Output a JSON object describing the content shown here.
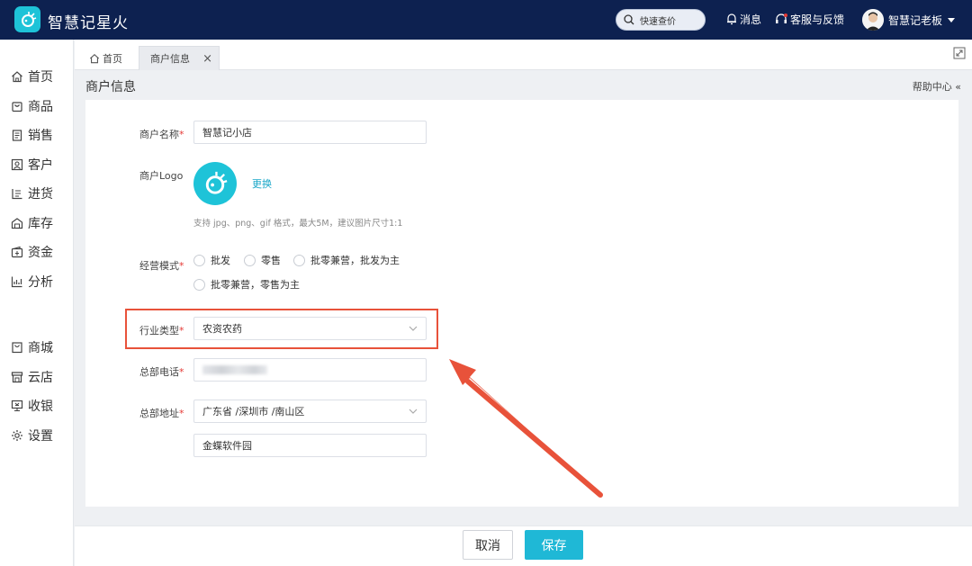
{
  "app": {
    "name": "智慧记星火"
  },
  "header": {
    "quick_search": "快速查价",
    "messages": "消息",
    "support": "客服与反馈",
    "user_name": "智慧记老板"
  },
  "sidebar": {
    "items": [
      {
        "label": "首页",
        "icon": "home-icon"
      },
      {
        "label": "商品",
        "icon": "bag-icon"
      },
      {
        "label": "销售",
        "icon": "clipboard-icon"
      },
      {
        "label": "客户",
        "icon": "contact-icon"
      },
      {
        "label": "进货",
        "icon": "purchase-icon"
      },
      {
        "label": "库存",
        "icon": "warehouse-icon"
      },
      {
        "label": "资金",
        "icon": "wallet-icon"
      },
      {
        "label": "分析",
        "icon": "chart-icon"
      },
      {
        "label": "商城",
        "icon": "mall-icon"
      },
      {
        "label": "云店",
        "icon": "store-icon"
      },
      {
        "label": "收银",
        "icon": "register-icon"
      },
      {
        "label": "设置",
        "icon": "gear-icon"
      }
    ]
  },
  "tabs": {
    "home": "首页",
    "active": "商户信息",
    "close": "×"
  },
  "page": {
    "title": "商户信息",
    "help": "帮助中心 «"
  },
  "form": {
    "name_label": "商户名称",
    "name_value": "智慧记小店",
    "logo_label": "商户Logo",
    "logo_change": "更换",
    "logo_hint": "支持 jpg、png、gif 格式，最大5M，建议图片尺寸1:1",
    "mode_label": "经营模式",
    "modes": [
      "批发",
      "零售",
      "批零兼营，批发为主",
      "批零兼营，零售为主"
    ],
    "industry_label": "行业类型",
    "industry_value": "农资农药",
    "phone_label": "总部电话",
    "address_label": "总部地址",
    "region_value": "广东省 /深圳市 /南山区",
    "street_value": "金蝶软件园",
    "required_mark": "*"
  },
  "footer": {
    "cancel": "取消",
    "save": "保存"
  },
  "colors": {
    "nav_bg": "#0d2150",
    "accent": "#1fb8d6",
    "highlight": "#e8523a",
    "required": "#e53935"
  }
}
